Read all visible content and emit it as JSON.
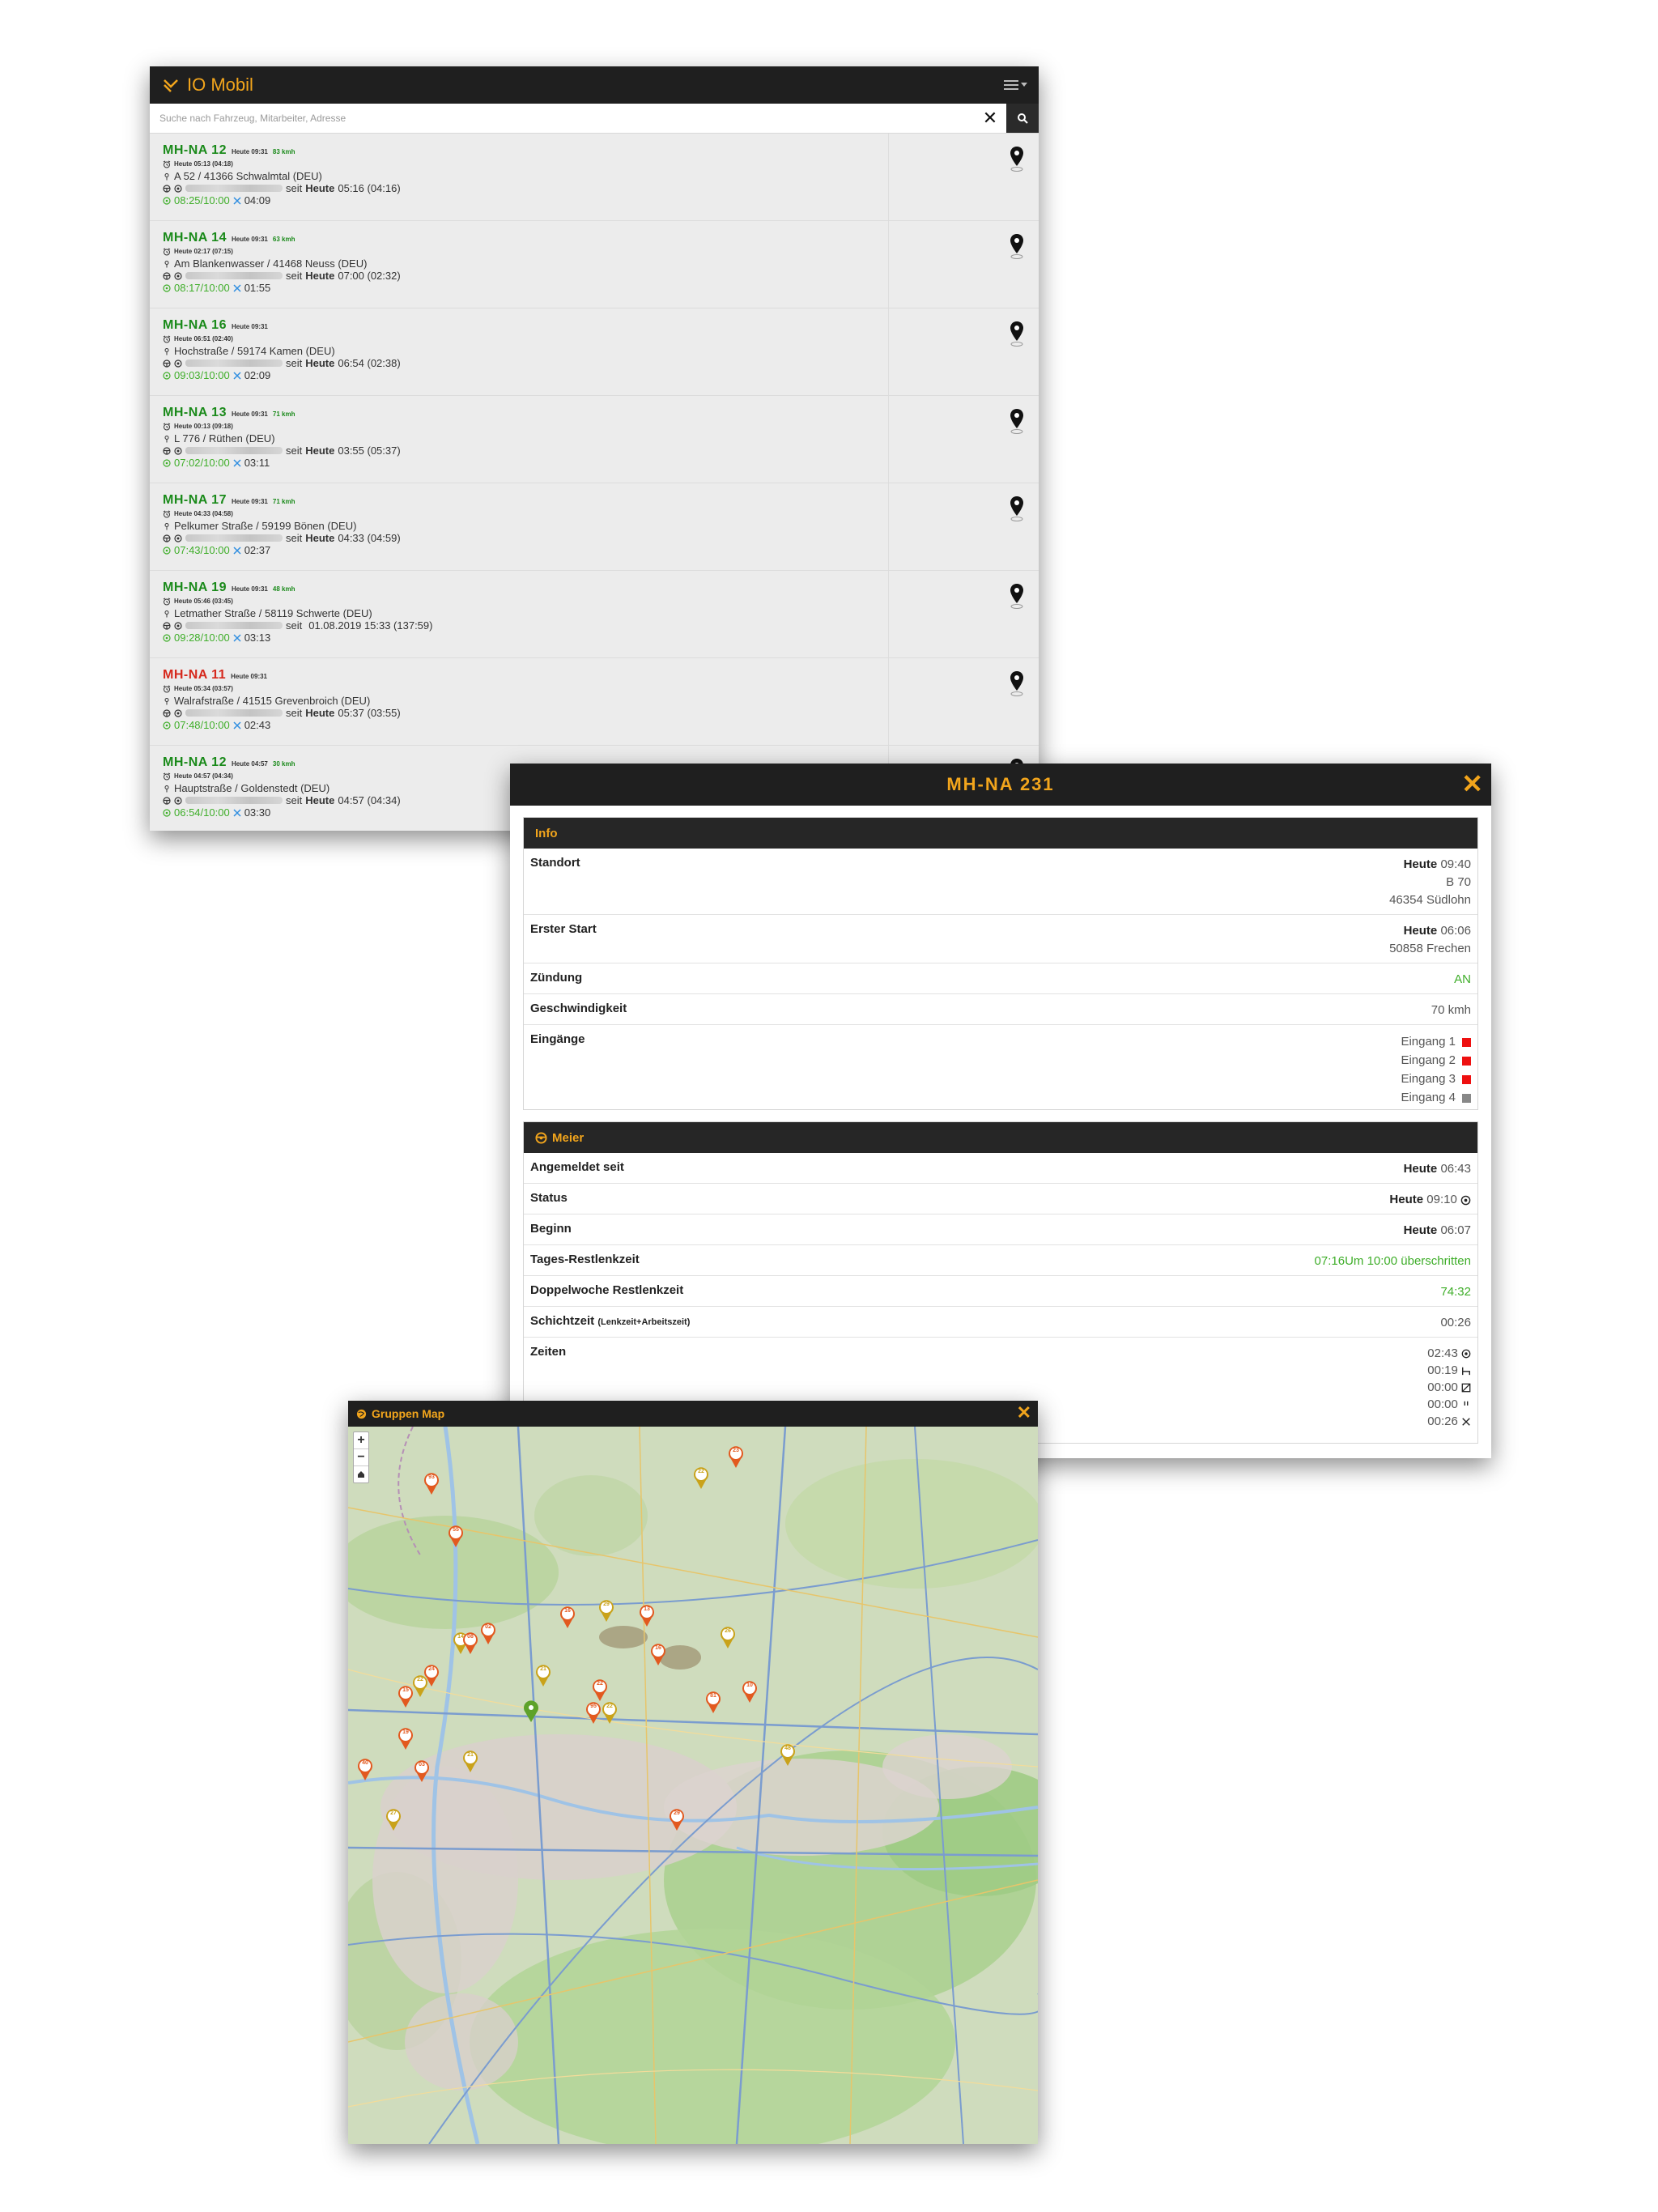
{
  "list": {
    "app_title": "IO Mobil",
    "search_placeholder": "Suche nach Fahrzeug, Mitarbeiter, Adresse",
    "clear_label": "✕",
    "vehicles": [
      {
        "plate": "MH-NA 12",
        "status": "green",
        "time": "Heute 09:31",
        "speed": "83 kmh",
        "start": "Heute 05:13 (04:18)",
        "address": "A 52 / 41366 Schwalmtal (DEU)",
        "since": "seit",
        "since_bold": "Heute",
        "since_rest": "05:16 (04:16)",
        "drive": "08:25/10:00",
        "rest": "04:09"
      },
      {
        "plate": "MH-NA 14",
        "status": "green",
        "time": "Heute 09:31",
        "speed": "63 kmh",
        "start": "Heute 02:17 (07:15)",
        "address": "Am Blankenwasser / 41468 Neuss (DEU)",
        "since": "seit",
        "since_bold": "Heute",
        "since_rest": "07:00 (02:32)",
        "drive": "08:17/10:00",
        "rest": "01:55"
      },
      {
        "plate": "MH-NA 16",
        "status": "green",
        "time": "Heute 09:31",
        "speed": "",
        "start": "Heute 06:51 (02:40)",
        "address": "Hochstraße / 59174 Kamen (DEU)",
        "since": "seit",
        "since_bold": "Heute",
        "since_rest": "06:54 (02:38)",
        "drive": "09:03/10:00",
        "rest": "02:09"
      },
      {
        "plate": "MH-NA 13",
        "status": "green",
        "time": "Heute 09:31",
        "speed": "71 kmh",
        "start": "Heute 00:13 (09:18)",
        "address": "L 776 / Rüthen (DEU)",
        "since": "seit",
        "since_bold": "Heute",
        "since_rest": "03:55 (05:37)",
        "drive": "07:02/10:00",
        "rest": "03:11"
      },
      {
        "plate": "MH-NA 17",
        "status": "green",
        "time": "Heute 09:31",
        "speed": "71 kmh",
        "start": "Heute 04:33 (04:58)",
        "address": "Pelkumer Straße / 59199 Bönen (DEU)",
        "since": "seit",
        "since_bold": "Heute",
        "since_rest": "04:33 (04:59)",
        "drive": "07:43/10:00",
        "rest": "02:37"
      },
      {
        "plate": "MH-NA 19",
        "status": "green",
        "time": "Heute 09:31",
        "speed": "48 kmh",
        "start": "Heute 05:46 (03:45)",
        "address": "Letmather Straße / 58119 Schwerte (DEU)",
        "since": "seit",
        "since_bold": "",
        "since_rest": "01.08.2019 15:33 (137:59)",
        "drive": "09:28/10:00",
        "rest": "03:13"
      },
      {
        "plate": "MH-NA 11",
        "status": "red",
        "time": "Heute 09:31",
        "speed": "",
        "start": "Heute 05:34 (03:57)",
        "address": "Walrafstraße / 41515 Grevenbroich (DEU)",
        "since": "seit",
        "since_bold": "Heute",
        "since_rest": "05:37 (03:55)",
        "drive": "07:48/10:00",
        "rest": "02:43"
      },
      {
        "plate": "MH-NA 12",
        "status": "green",
        "time": "Heute 04:57",
        "speed": "30 kmh",
        "start": "Heute 04:57 (04:34)",
        "address": "Hauptstraße / Goldenstedt (DEU)",
        "since": "seit",
        "since_bold": "Heute",
        "since_rest": "04:57 (04:34)",
        "drive": "06:54/10:00",
        "rest": "03:30"
      }
    ]
  },
  "detail": {
    "title": "MH-NA 231",
    "close": "✕",
    "info_title": "Info",
    "standort_label": "Standort",
    "standort_day": "Heute",
    "standort_time": "09:40",
    "standort_road": "B 70",
    "standort_city": "46354 Südlohn",
    "erster_start_label": "Erster Start",
    "erster_start_day": "Heute",
    "erster_start_time": "06:06",
    "erster_start_city": "50858 Frechen",
    "zuendung_label": "Zündung",
    "zuendung_value": "AN",
    "geschwindigkeit_label": "Geschwindigkeit",
    "geschwindigkeit_value": "70 kmh",
    "eingaenge_label": "Eingänge",
    "eingaenge": [
      "Eingang 1",
      "Eingang 2",
      "Eingang 3",
      "Eingang 4"
    ],
    "driver_title": "Meier",
    "angemeldet_label": "Angemeldet seit",
    "angemeldet_day": "Heute",
    "angemeldet_time": "06:43",
    "status_label": "Status",
    "status_day": "Heute",
    "status_time": "09:10",
    "beginn_label": "Beginn",
    "beginn_day": "Heute",
    "beginn_time": "06:07",
    "tages_label": "Tages-Restlenkzeit",
    "tages_value": "07:16Um 10:00 überschritten",
    "doppel_label": "Doppelwoche Restlenkzeit",
    "doppel_value": "74:32",
    "schicht_label": "Schichtzeit",
    "schicht_sub": "(Lenkzeit+Arbeitszeit)",
    "schicht_value": "00:26",
    "zeiten_label": "Zeiten",
    "zeiten": [
      "02:43",
      "00:19",
      "00:00",
      "00:00",
      "00:26"
    ]
  },
  "map": {
    "title": "Gruppen Map",
    "close": "✕",
    "zoom_in": "+",
    "zoom_out": "−",
    "markers": [
      "93",
      "22",
      "23",
      "16",
      "29",
      "13",
      "16",
      "26",
      "02",
      "14",
      "08",
      "24",
      "22",
      "15",
      "19",
      "21",
      "22",
      "22",
      "95",
      "55",
      "21",
      "81",
      "10",
      "48",
      "03",
      "27",
      "29",
      "40"
    ]
  }
}
